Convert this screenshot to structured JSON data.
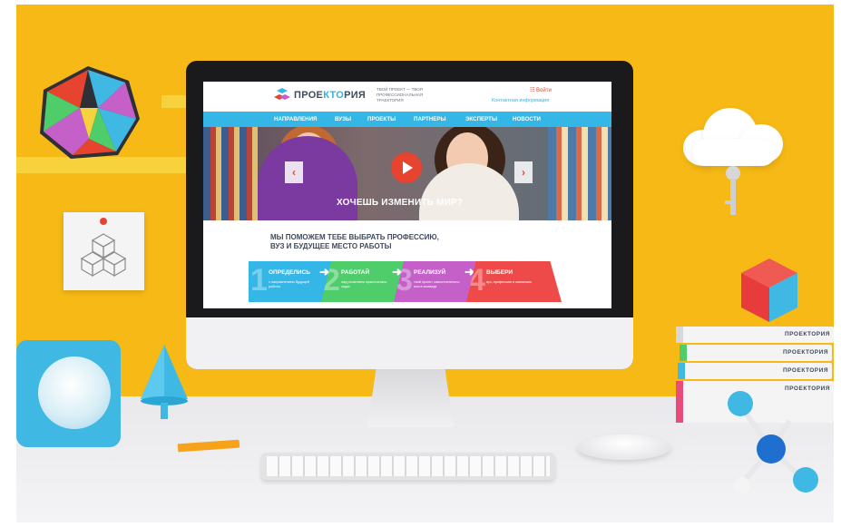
{
  "site": {
    "logo_prefix": "ПРОЕ",
    "logo_accent": "КТО",
    "logo_suffix": "РИЯ",
    "tagline": "ТВОЙ ПРОЕКТ — ТВОЯ ПРОФЕССИОНАЛЬНАЯ ТРАЕКТОРИЯ",
    "login": "Войти",
    "contact": "Контактная информация"
  },
  "nav": [
    "НАПРАВЛЕНИЯ",
    "ВУЗЫ",
    "ПРОЕКТЫ",
    "ПАРТНЕРЫ",
    "ЭКСПЕРТЫ",
    "НОВОСТИ"
  ],
  "hero": {
    "title": "ХОЧЕШЬ ИЗМЕНИТЬ МИР?",
    "prev": "‹",
    "next": "›"
  },
  "slogan": {
    "line1": "МЫ ПОМОЖЕМ ТЕБЕ ВЫБРАТЬ ПРОФЕССИЮ,",
    "line2": "ВУЗ И БУДУЩЕЕ МЕСТО РАБОТЫ"
  },
  "steps": [
    {
      "num": "1",
      "title": "ОПРЕДЕЛИСЬ",
      "desc": "с направлением будущей работы",
      "color": "#34b6e6"
    },
    {
      "num": "2",
      "title": "РАБОТАЙ",
      "desc": "над решением практических задач",
      "color": "#4fcd6a"
    },
    {
      "num": "3",
      "title": "РЕАЛИЗУЙ",
      "desc": "твой проект самостоятельно или в команде",
      "color": "#c560c9"
    },
    {
      "num": "4",
      "title": "ВЫБЕРИ",
      "desc": "вуз, профессию и компанию",
      "color": "#ef4a4a"
    }
  ],
  "books": [
    "ПРОЕКТОРИЯ",
    "ПРОЕКТОРИЯ",
    "ПРОЕКТОРИЯ",
    "ПРОЕКТОРИЯ"
  ],
  "colors": {
    "background": "#f6b916",
    "accent_blue": "#34b6e6",
    "accent_red": "#e7442f"
  }
}
